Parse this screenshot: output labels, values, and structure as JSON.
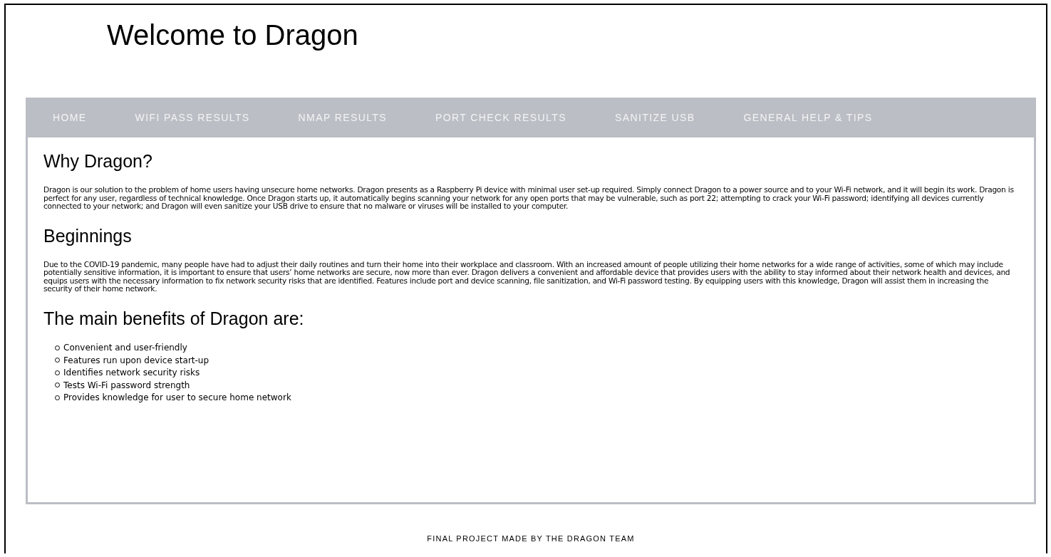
{
  "page_title": "Welcome to Dragon",
  "nav": [
    "HOME",
    "WIFI PASS RESULTS",
    "NMAP RESULTS",
    "PORT CHECK RESULTS",
    "SANITIZE USB",
    "GENERAL HELP & TIPS"
  ],
  "sections": [
    {
      "heading": "Why Dragon?",
      "kind": "paragraph",
      "text": "Dragon is our solution to the problem of home users having unsecure home networks. Dragon presents as a Raspberry Pi device with minimal user set-up required. Simply connect Dragon to a power source and to your Wi-Fi network, and it will begin its work. Dragon is perfect for any user, regardless of technical knowledge. Once Dragon starts up, it automatically begins scanning your network for any open ports that may be vulnerable, such as port 22; attempting to crack your Wi-Fi password; identifying all devices currently connected to your network; and Dragon will even sanitize your USB drive to ensure that no malware or viruses will be installed to your computer."
    },
    {
      "heading": "Beginnings",
      "kind": "paragraph",
      "text": "Due to the COVID-19 pandemic, many people have had to adjust their daily routines and turn their home into their workplace and classroom. With an increased amount of people utilizing their home networks for a wide range of activities, some of which may include potentially sensitive information, it is important to ensure that users’ home networks are secure, now more than ever. Dragon delivers a convenient and affordable device that provides users with the ability to stay informed about their network health and devices, and equips users with the necessary information to fix network security risks that are identified. Features include port and device scanning, file sanitization, and Wi-Fi password testing. By equipping users with this knowledge, Dragon will assist them in increasing the security of their home network."
    },
    {
      "heading": "The main benefits of Dragon are:",
      "kind": "list",
      "items": [
        "Convenient and user-friendly",
        "Features run upon device start-up",
        "Identifies network security risks",
        "Tests Wi-Fi password strength",
        "Provides knowledge for user to secure home network"
      ]
    }
  ],
  "footer": "FINAL PROJECT MADE BY THE DRAGON TEAM"
}
